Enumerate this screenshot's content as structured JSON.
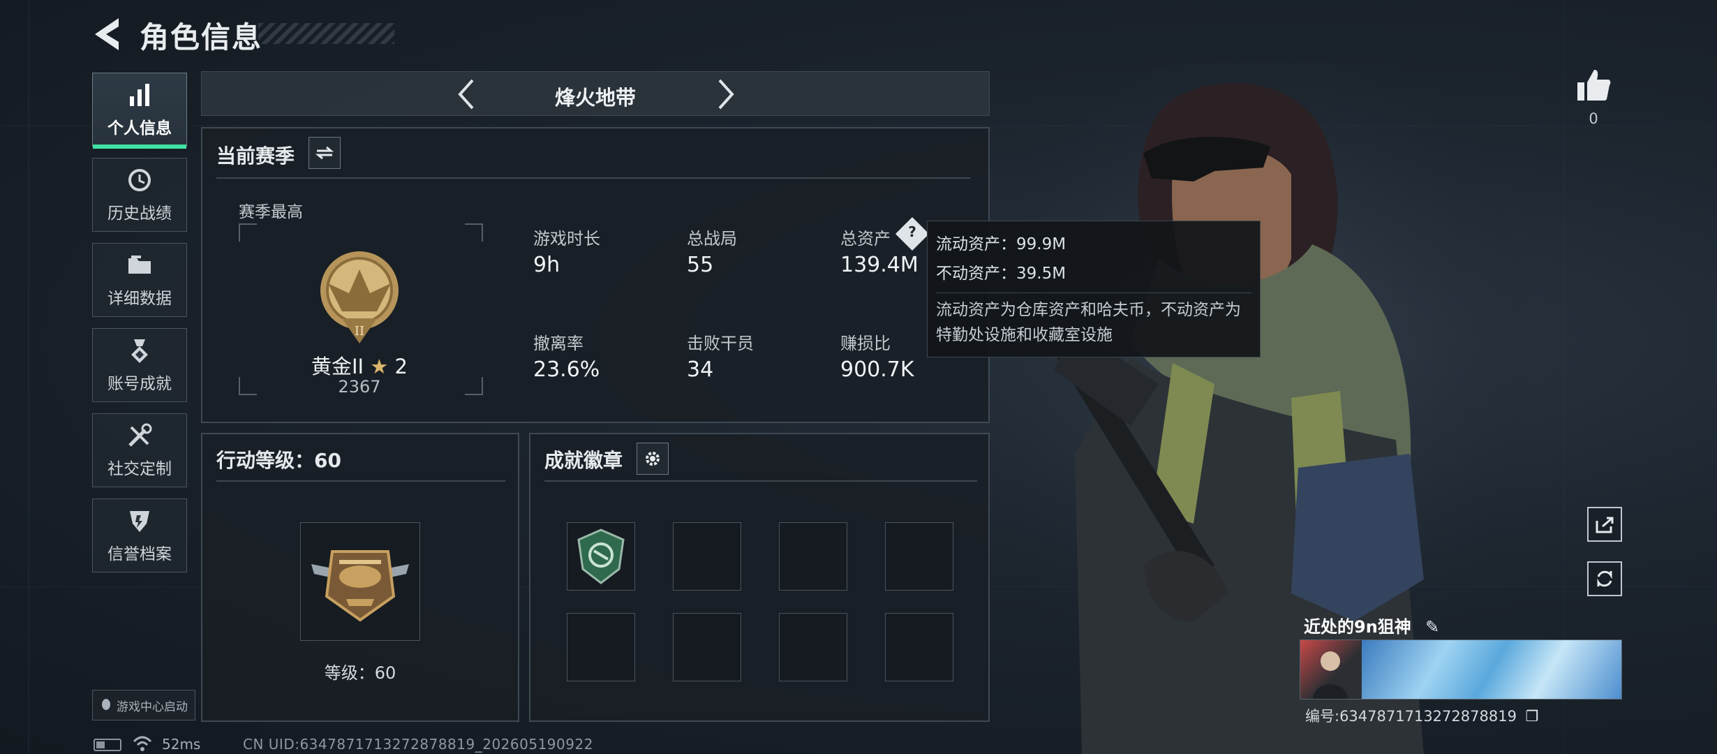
{
  "header": {
    "title": "角色信息",
    "back_icon": "arrow-left-icon"
  },
  "sidebar": {
    "items": [
      {
        "label": "个人信息",
        "icon": "bar-chart-icon",
        "active": true
      },
      {
        "label": "历史战绩",
        "icon": "history-icon",
        "active": false
      },
      {
        "label": "详细数据",
        "icon": "folder-icon",
        "active": false
      },
      {
        "label": "账号成就",
        "icon": "medal-icon",
        "active": false
      },
      {
        "label": "社交定制",
        "icon": "tools-icon",
        "active": false
      },
      {
        "label": "信誉档案",
        "icon": "shield-icon",
        "active": false
      }
    ],
    "launch_label": "游戏中心启动"
  },
  "mode_selector": {
    "name": "烽火地带"
  },
  "season": {
    "title": "当前赛季",
    "best_label": "赛季最高",
    "rank_name": "黄金II",
    "rank_stars": "2",
    "rank_score": "2367",
    "stats": [
      {
        "label": "游戏时长",
        "value": "9h"
      },
      {
        "label": "总战局",
        "value": "55"
      },
      {
        "label": "总资产",
        "value": "139.4M"
      },
      {
        "label": "撤离率",
        "value": "23.6%"
      },
      {
        "label": "击败干员",
        "value": "34"
      },
      {
        "label": "赚损比",
        "value": "900.7K"
      }
    ]
  },
  "tooltip": {
    "liquid": "流动资产：99.9M",
    "fixed": "不动资产：39.5M",
    "note": "流动资产为仓库资产和哈夫币，不动资产为特勤处设施和收藏室设施"
  },
  "action_level": {
    "title": "行动等级：60",
    "level_text": "等级：60"
  },
  "achievements": {
    "title": "成就徽章"
  },
  "profile": {
    "likes": "0",
    "player_name": "近处的9n狙神",
    "player_id": "编号:6347871713272878819"
  },
  "footer": {
    "ping": "52ms",
    "uid": "CN UID:6347871713272878819_202605190922"
  },
  "colors": {
    "accent": "#3fe3a3",
    "panel_border": "#3f4953",
    "background": "#1b232c"
  }
}
